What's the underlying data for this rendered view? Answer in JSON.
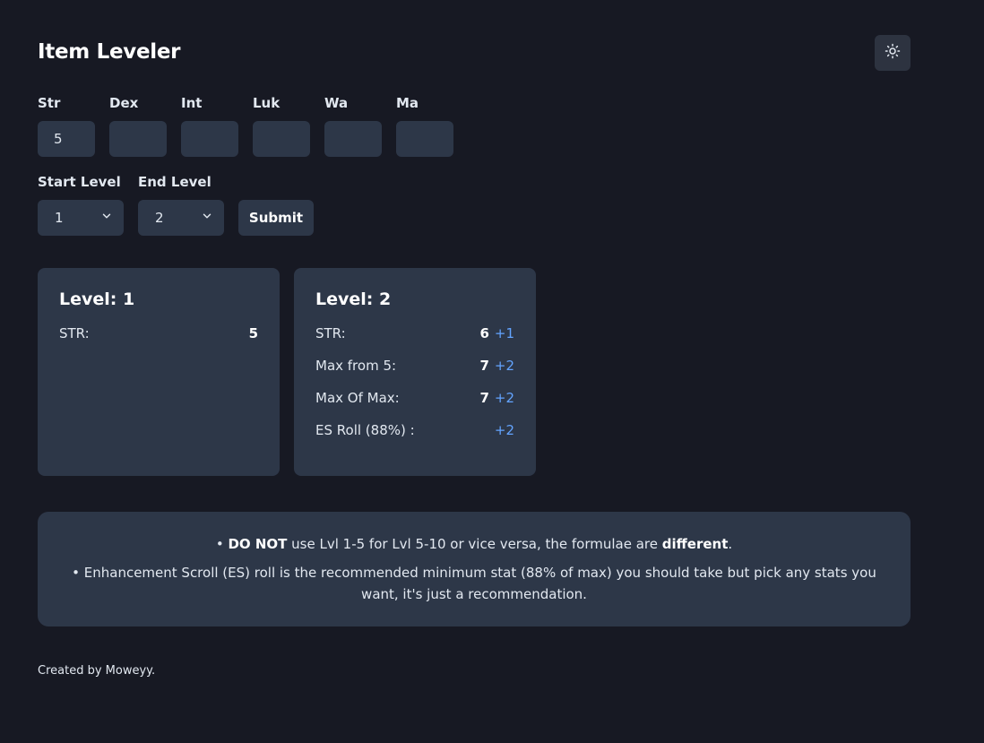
{
  "header": {
    "title": "Item Leveler",
    "theme_icon": "sun-icon"
  },
  "stats": [
    {
      "label": "Str",
      "value": "5"
    },
    {
      "label": "Dex",
      "value": ""
    },
    {
      "label": "Int",
      "value": ""
    },
    {
      "label": "Luk",
      "value": ""
    },
    {
      "label": "Wa",
      "value": ""
    },
    {
      "label": "Ma",
      "value": ""
    }
  ],
  "levels": {
    "start_label": "Start Level",
    "start_value": "1",
    "end_label": "End Level",
    "end_value": "2",
    "submit_label": "Submit"
  },
  "cards": [
    {
      "title": "Level: 1",
      "rows": [
        {
          "label": "STR:",
          "value": "5",
          "increase": ""
        }
      ]
    },
    {
      "title": "Level: 2",
      "rows": [
        {
          "label": "STR:",
          "value": "6",
          "increase": "+1"
        },
        {
          "label": "Max from 5:",
          "value": "7",
          "increase": "+2"
        },
        {
          "label": "Max Of Max:",
          "value": "7",
          "increase": "+2"
        },
        {
          "label": "ES Roll (88%) :",
          "value": "",
          "increase": "+2"
        }
      ]
    }
  ],
  "notes": {
    "note1_bullet": "• ",
    "note1_bold1": "DO NOT",
    "note1_text": " use Lvl 1-5 for Lvl 5-10 or vice versa, the formulae are ",
    "note1_bold2": "different",
    "note1_end": ".",
    "note2": "• Enhancement Scroll (ES) roll is the recommended minimum stat (88% of max) you should take but pick any stats you want, it's just a recommendation."
  },
  "footer": {
    "text": "Created by Moweyy."
  },
  "colors": {
    "background": "#171923",
    "panel": "#2d3748",
    "increase": "#63a4ff"
  }
}
